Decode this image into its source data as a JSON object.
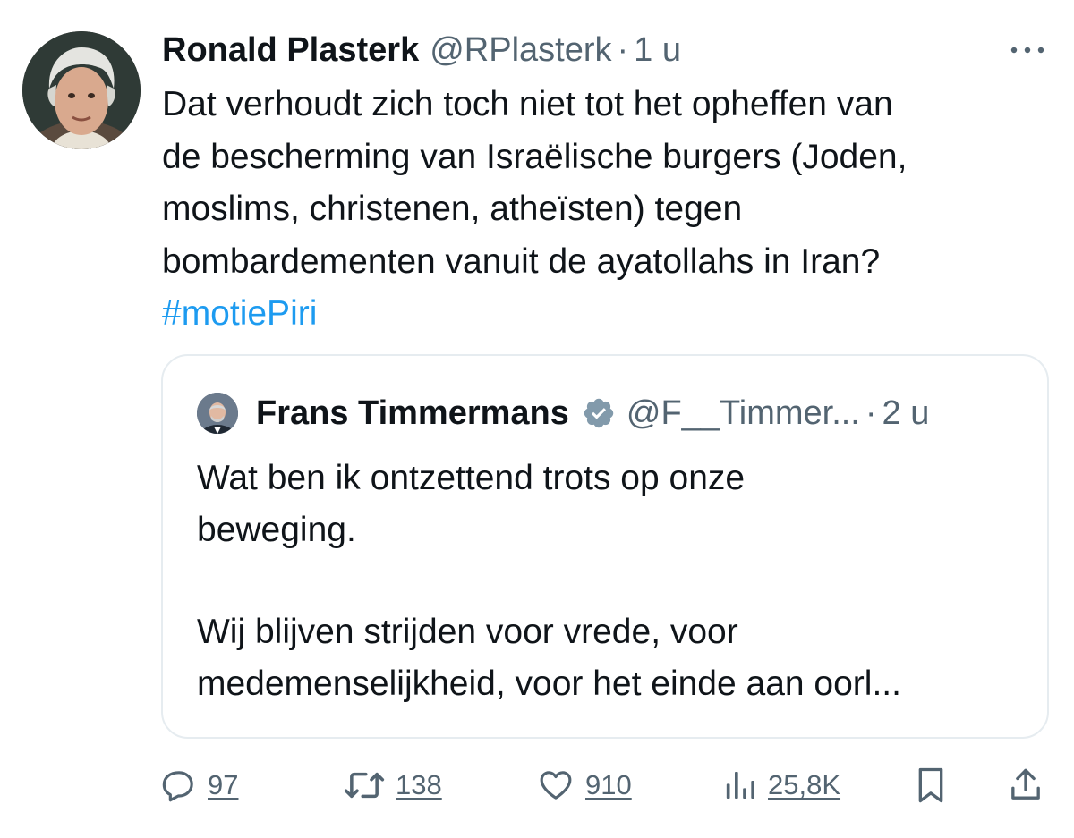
{
  "tweet": {
    "author_name": "Ronald Plasterk",
    "author_handle": "@RPlasterk",
    "separator": "·",
    "time": "1 u",
    "text_lines": [
      "Dat verhoudt zich toch niet tot het opheffen van",
      "de bescherming van Israëlische burgers (Joden,",
      "moslims, christenen, atheïsten) tegen",
      "bombardementen vanuit de ayatollahs in Iran?"
    ],
    "hashtag": "#motiePiri",
    "avatar_icon": "user-avatar-photo",
    "more_icon": "more-horizontal-icon"
  },
  "quote": {
    "author_name": "Frans Timmermans",
    "verified_icon": "verified-badge-icon",
    "author_handle": "@F__Timmer...",
    "separator": "·",
    "time": "2 u",
    "text_lines_1": [
      "Wat ben ik ontzettend trots op onze",
      "beweging."
    ],
    "text_lines_2": [
      "Wij blijven strijden voor vrede, voor",
      "medemenselijkheid, voor het einde aan oorl..."
    ]
  },
  "actions": {
    "reply": {
      "icon": "reply-icon",
      "count": "97"
    },
    "retweet": {
      "icon": "retweet-icon",
      "count": "138"
    },
    "like": {
      "icon": "heart-icon",
      "count": "910"
    },
    "views": {
      "icon": "views-chart-icon",
      "count": "25,8K"
    },
    "bookmark": {
      "icon": "bookmark-icon"
    },
    "share": {
      "icon": "share-icon"
    }
  },
  "colors": {
    "text": "#0f1419",
    "secondary": "#536471",
    "link": "#1d9bf0",
    "border": "#e6ecf0",
    "verified_badge": "#829aab"
  }
}
